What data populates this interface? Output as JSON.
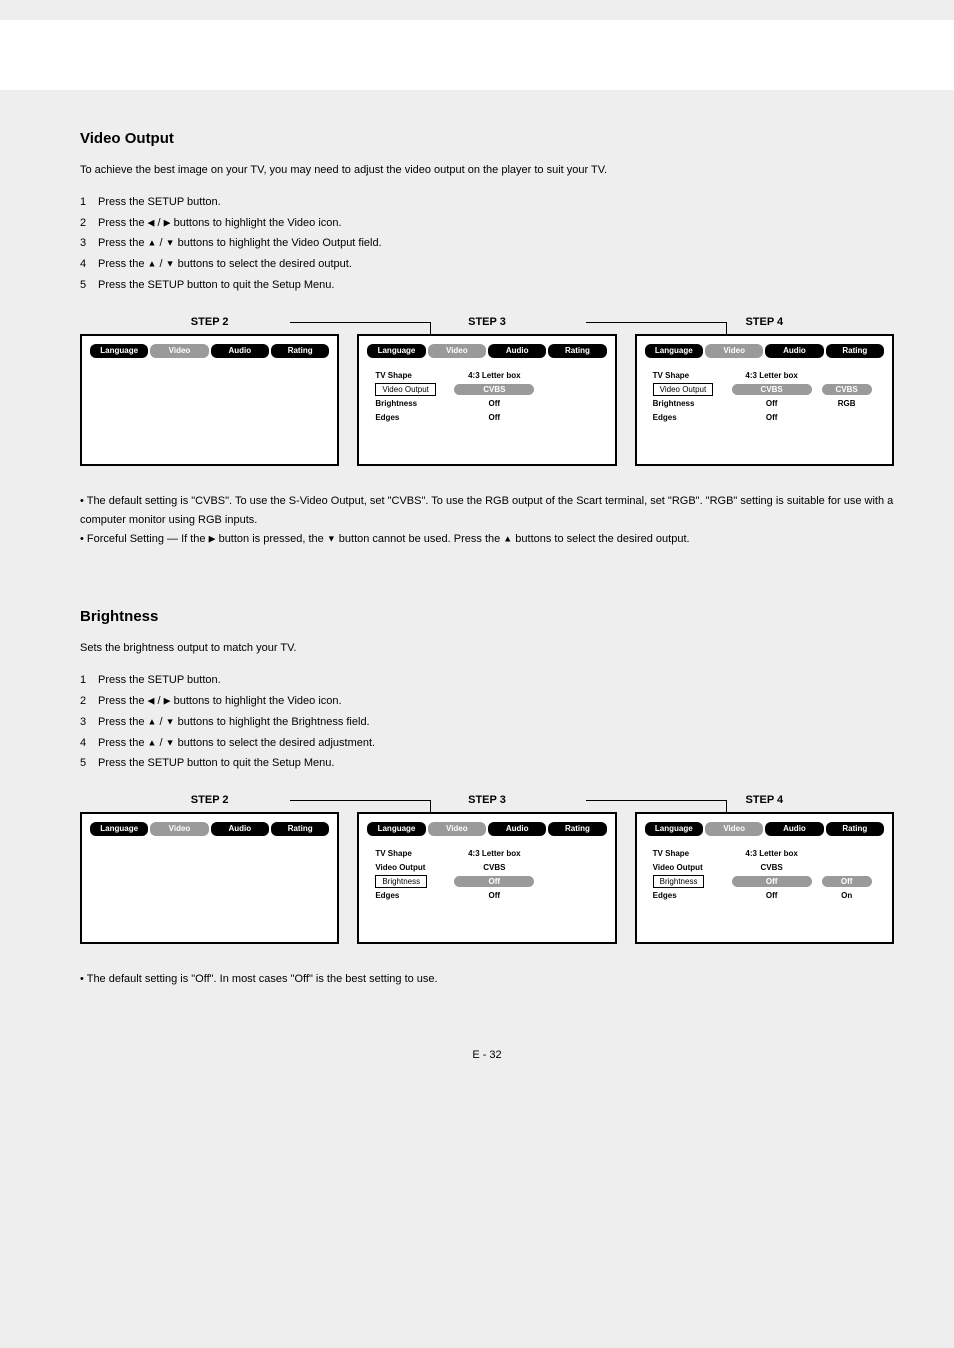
{
  "tabs": {
    "language": "Language",
    "video": "Video",
    "audio": "Audio",
    "rating": "Rating"
  },
  "fields": {
    "tvshape": "TV Shape",
    "videooutput": "Video Output",
    "brightness": "Brightness",
    "edges": "Edges"
  },
  "vals": {
    "letterbox": "4:3 Letter box",
    "cvbs": "CVBS",
    "rgb": "RGB",
    "off": "Off",
    "on": "On"
  },
  "steplabels": {
    "s2": "STEP 2",
    "s3": "STEP 3",
    "s4": "STEP 4"
  },
  "videoOutput": {
    "title": "Video Output",
    "intro": "To achieve the best image on your TV, you may need to adjust the video output on the player to suit your TV.",
    "s1p": "Press the SETUP button.",
    "s2a": "Press the ",
    "s2b": " buttons to highlight the Video icon.",
    "s3a": "Press the ",
    "s3b": " buttons to highlight the Video Output field.",
    "s4a": "Press the ",
    "s4b": " buttons to select the desired output.",
    "s5": "Press the SETUP button to quit the Setup Menu.",
    "note1a": "The default setting is \"CVBS\". To use the S-Video Output, set \"CVBS\". To use the RGB output of the Scart terminal, set \"RGB\". \"RGB\" setting is suitable for use with a computer monitor using RGB inputs.",
    "note1b_a": "Forceful Setting — If the ",
    "note1b_b": " button is pressed, the ",
    "note1b_c": " button cannot be used. Press the ",
    "note1b_d": " buttons to select the desired output."
  },
  "brightness": {
    "title": "Brightness",
    "intro": "Sets the brightness output to match your TV.",
    "s1p": "Press the SETUP button.",
    "s2a": "Press the ",
    "s2b": " buttons to highlight the Video icon.",
    "s3a": "Press the ",
    "s3b": " buttons to highlight the Brightness field.",
    "s4a": "Press the ",
    "s4b": " buttons to select the desired adjustment.",
    "s5": "Press the SETUP button to quit the Setup Menu.",
    "note": "The default setting is \"Off\". In most cases \"Off\" is the best setting to use."
  },
  "pagenum": "E - 32",
  "numbers": {
    "n1": "1",
    "n2": "2",
    "n3": "3",
    "n4": "4",
    "n5": "5"
  }
}
